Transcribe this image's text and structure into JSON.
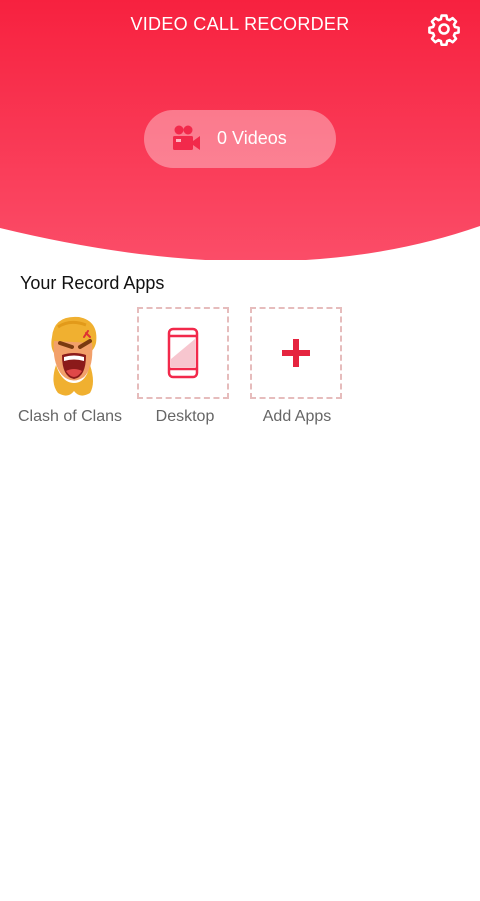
{
  "header": {
    "title": "VIDEO CALL RECORDER",
    "settings_icon": "gear-icon",
    "videos_count_label": "0 Videos",
    "videos_icon": "video-camera-icon"
  },
  "section": {
    "title": "Your Record Apps"
  },
  "apps": [
    {
      "label": "Clash of Clans",
      "icon": "clash-of-clans-app-icon"
    },
    {
      "label": "Desktop",
      "icon": "phone-icon"
    },
    {
      "label": "Add Apps",
      "icon": "plus-icon"
    }
  ],
  "colors": {
    "accent": "#f2294b",
    "header_top": "#f7213f",
    "header_bottom": "#fb4a66",
    "dashed_border": "#e6bcbc",
    "label_gray": "#666666"
  }
}
